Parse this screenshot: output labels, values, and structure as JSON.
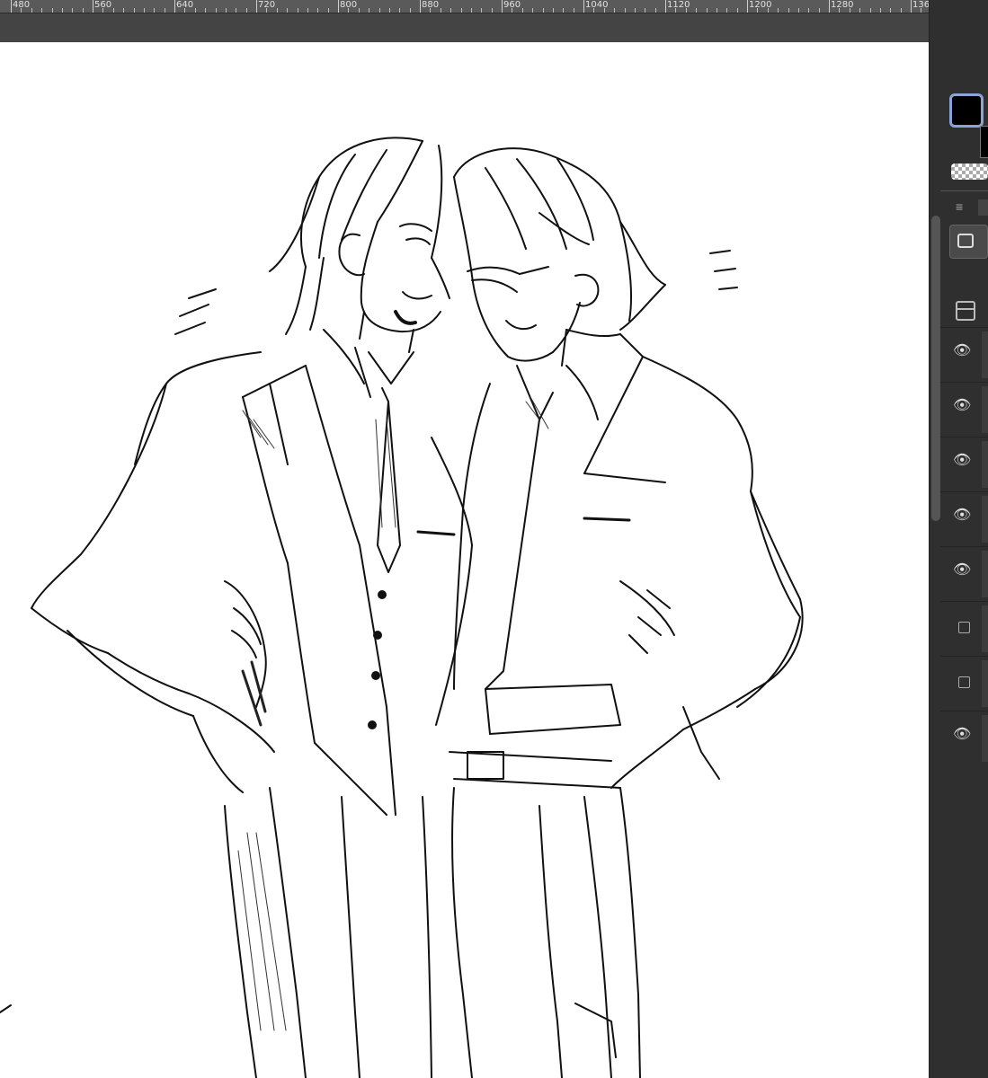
{
  "ruler": {
    "labels": [
      "480",
      "560",
      "640",
      "720",
      "800",
      "880",
      "960",
      "1040",
      "1120",
      "1200",
      "1280",
      "136"
    ]
  },
  "layers": [
    {
      "visible": true
    },
    {
      "visible": true
    },
    {
      "visible": true
    },
    {
      "visible": true
    },
    {
      "visible": true
    },
    {
      "visible": false
    },
    {
      "visible": false
    },
    {
      "visible": true
    }
  ],
  "colors": {
    "main": "#000000",
    "sub": "#000000",
    "panel": "#2f2f2f",
    "accent": "#8aa4d6"
  },
  "icons": {
    "eye": "eye-icon",
    "menu": "hamburger-icon",
    "selection": "rectangle-select-icon",
    "layer_property": "layer-property-icon"
  }
}
